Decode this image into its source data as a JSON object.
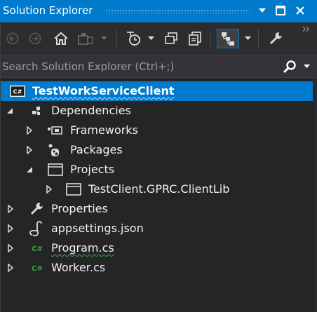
{
  "window": {
    "title": "Solution Explorer",
    "buttons": [
      "dropdown-icon",
      "maximize-icon",
      "close-icon"
    ]
  },
  "toolbar": {
    "items": [
      "back-icon",
      "forward-icon",
      "home-icon",
      "switch-views-icon",
      "dropdown-icon",
      "pending-changes-filter-icon",
      "dropdown-icon",
      "sync-active-document-icon",
      "collapse-all-icon",
      "sync-with-active-document-icon",
      "dropdown-icon",
      "properties-icon"
    ]
  },
  "search": {
    "placeholder": "Search Solution Explorer (Ctrl+;)",
    "value": ""
  },
  "tree": {
    "project": "TestWorkServiceClient",
    "project_badge": "C#",
    "dependencies": "Dependencies",
    "frameworks": "Frameworks",
    "packages": "Packages",
    "projects": "Projects",
    "client_lib": "TestClient.GPRC.ClientLib",
    "properties": "Properties",
    "appsettings": "appsettings.json",
    "program": "Program.cs",
    "worker": "Worker.cs",
    "cs_badge": "C#"
  },
  "colors": {
    "accent": "#007acc",
    "background": "#252526",
    "toolbar": "#2d2d30",
    "text": "#f1f1f1",
    "csharp_icon": "#3ea63e"
  }
}
